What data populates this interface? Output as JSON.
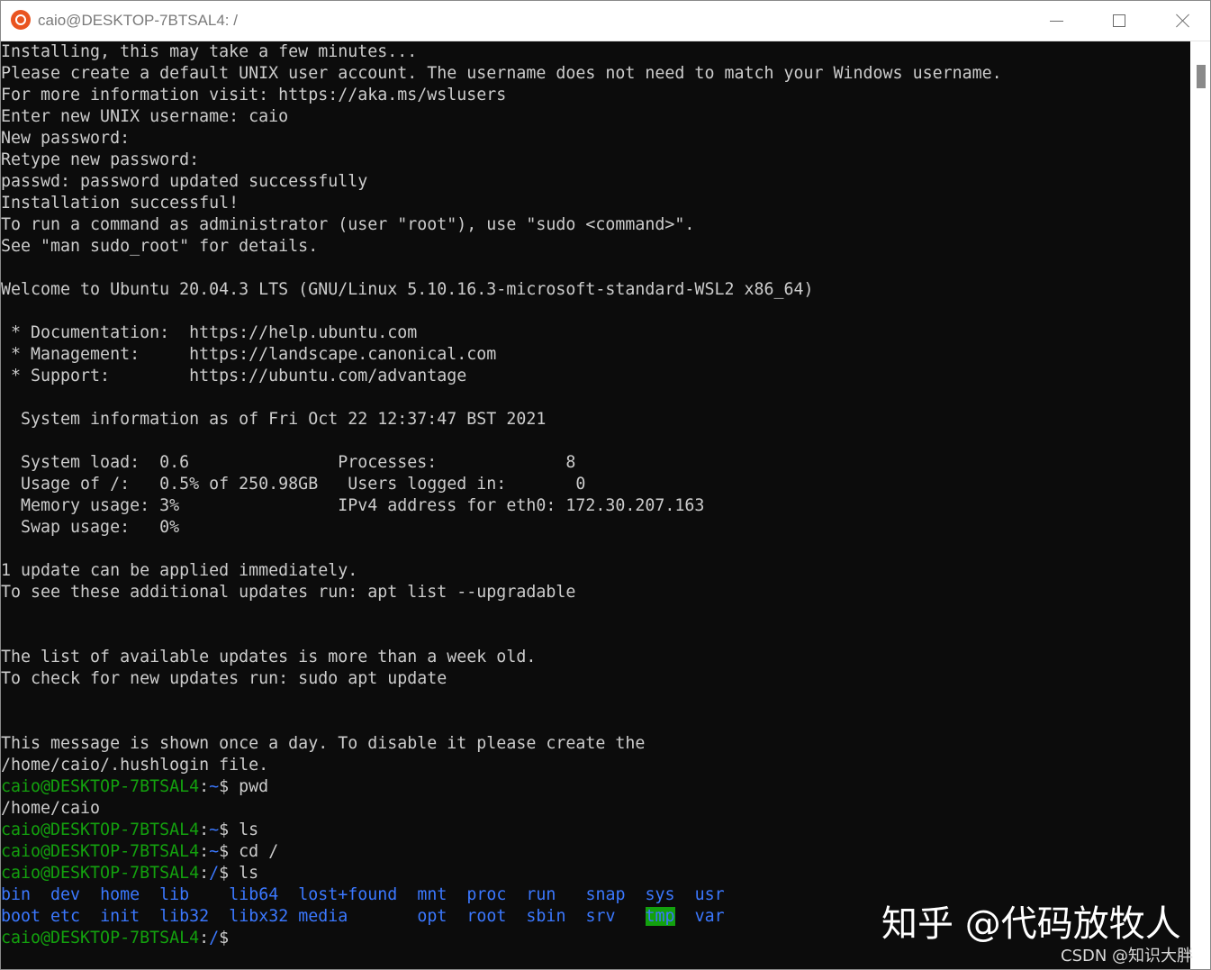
{
  "window": {
    "title": "caio@DESKTOP-7BTSAL4: /",
    "app_icon": "ubuntu-icon",
    "buttons": [
      "minimize-icon",
      "maximize-icon",
      "close-icon"
    ]
  },
  "terminal": {
    "output_lines": [
      "Installing, this may take a few minutes...",
      "Please create a default UNIX user account. The username does not need to match your Windows username.",
      "For more information visit: https://aka.ms/wslusers",
      "Enter new UNIX username: caio",
      "New password:",
      "Retype new password:",
      "passwd: password updated successfully",
      "Installation successful!",
      "To run a command as administrator (user \"root\"), use \"sudo <command>\".",
      "See \"man sudo_root\" for details.",
      "",
      "Welcome to Ubuntu 20.04.3 LTS (GNU/Linux 5.10.16.3-microsoft-standard-WSL2 x86_64)",
      "",
      " * Documentation:  https://help.ubuntu.com",
      " * Management:     https://landscape.canonical.com",
      " * Support:        https://ubuntu.com/advantage",
      "",
      "  System information as of Fri Oct 22 12:37:47 BST 2021",
      "",
      "  System load:  0.6               Processes:             8",
      "  Usage of /:   0.5% of 250.98GB   Users logged in:       0",
      "  Memory usage: 3%                IPv4 address for eth0: 172.30.207.163",
      "  Swap usage:   0%",
      "",
      "1 update can be applied immediately.",
      "To see these additional updates run: apt list --upgradable",
      "",
      "",
      "The list of available updates is more than a week old.",
      "To check for new updates run: sudo apt update",
      "",
      "",
      "This message is shown once a day. To disable it please create the",
      "/home/caio/.hushlogin file."
    ],
    "session": [
      {
        "user": "caio@DESKTOP-7BTSAL4",
        "path": "~",
        "cmd": "pwd"
      },
      {
        "output": "/home/caio"
      },
      {
        "user": "caio@DESKTOP-7BTSAL4",
        "path": "~",
        "cmd": "ls"
      },
      {
        "user": "caio@DESKTOP-7BTSAL4",
        "path": "~",
        "cmd": "cd /"
      },
      {
        "user": "caio@DESKTOP-7BTSAL4",
        "path": "/",
        "cmd": "ls"
      }
    ],
    "ls_rows": [
      [
        {
          "text": "bin",
          "pad": "  "
        },
        {
          "text": "dev",
          "pad": "  "
        },
        {
          "text": "home",
          "pad": "  "
        },
        {
          "text": "lib",
          "pad": "    "
        },
        {
          "text": "lib64",
          "pad": "  "
        },
        {
          "text": "lost+found",
          "pad": "  "
        },
        {
          "text": "mnt",
          "pad": "  "
        },
        {
          "text": "proc",
          "pad": "  "
        },
        {
          "text": "run",
          "pad": "   "
        },
        {
          "text": "snap",
          "pad": "  "
        },
        {
          "text": "sys",
          "pad": "  "
        },
        {
          "text": "usr",
          "pad": ""
        }
      ],
      [
        {
          "text": "boot",
          "pad": " "
        },
        {
          "text": "etc",
          "pad": "  "
        },
        {
          "text": "init",
          "pad": "  "
        },
        {
          "text": "lib32",
          "pad": "  "
        },
        {
          "text": "libx32",
          "pad": " "
        },
        {
          "text": "media",
          "pad": "       "
        },
        {
          "text": "opt",
          "pad": "  "
        },
        {
          "text": "root",
          "pad": "  "
        },
        {
          "text": "sbin",
          "pad": "  "
        },
        {
          "text": "srv",
          "pad": "   "
        },
        {
          "text": "tmp",
          "pad": "  ",
          "highlight": true
        },
        {
          "text": "var",
          "pad": ""
        }
      ]
    ],
    "final_prompt": {
      "user": "caio@DESKTOP-7BTSAL4",
      "path": "/",
      "cmd": ""
    },
    "colors": {
      "background": "#0c0c0c",
      "foreground": "#cccccc",
      "prompt_user": "#13a10e",
      "prompt_path": "#3b78ff",
      "directory": "#3b78ff",
      "sticky_dir_background": "#13a10e"
    }
  },
  "watermarks": {
    "zhihu": "知乎 @代码放牧人",
    "csdn": "CSDN @知识大胖"
  }
}
